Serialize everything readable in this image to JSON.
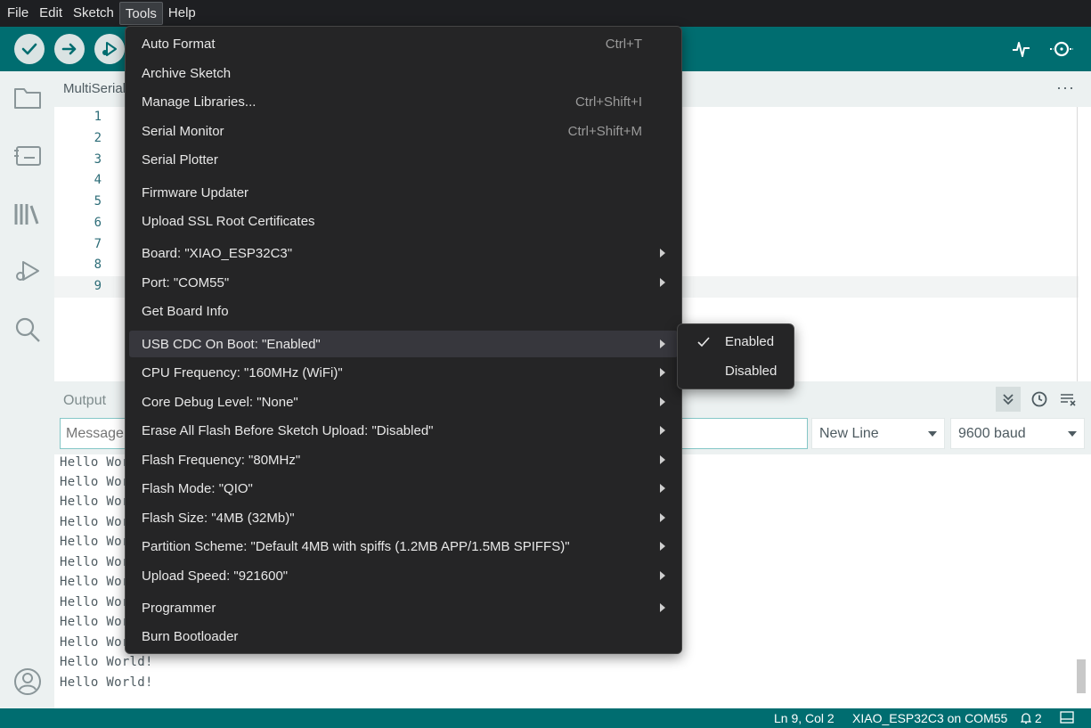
{
  "menubar": {
    "items": [
      "File",
      "Edit",
      "Sketch",
      "Tools",
      "Help"
    ]
  },
  "editor": {
    "tab_label": "MultiSerial",
    "more_label": "···",
    "line_numbers": [
      "1",
      "2",
      "3",
      "4",
      "5",
      "6",
      "7",
      "8",
      "9"
    ]
  },
  "output": {
    "title": "Output",
    "message_placeholder": "Message",
    "line_ending": "New Line",
    "baud": "9600 baud",
    "lines": [
      "Hello World!",
      "Hello World!",
      "Hello World!",
      "Hello World!",
      "Hello World!",
      "Hello World!",
      "Hello World!",
      "Hello World!",
      "Hello World!",
      "Hello World!",
      "Hello World!",
      "Hello World!"
    ]
  },
  "status": {
    "cursor": "Ln 9, Col 2",
    "board_port": "XIAO_ESP32C3 on COM55",
    "notifications": "2"
  },
  "tools_menu": {
    "items": [
      {
        "label": "Auto Format",
        "shortcut": "Ctrl+T"
      },
      {
        "label": "Archive Sketch"
      },
      {
        "label": "Manage Libraries...",
        "shortcut": "Ctrl+Shift+I"
      },
      {
        "label": "Serial Monitor",
        "shortcut": "Ctrl+Shift+M"
      },
      {
        "label": "Serial Plotter"
      },
      {
        "label": "Firmware Updater"
      },
      {
        "label": "Upload SSL Root Certificates"
      },
      {
        "label": "Board: \"XIAO_ESP32C3\"",
        "submenu": true
      },
      {
        "label": "Port: \"COM55\"",
        "submenu": true
      },
      {
        "label": "Get Board Info"
      },
      {
        "label": "USB CDC On Boot: \"Enabled\"",
        "submenu": true,
        "highlighted": true
      },
      {
        "label": "CPU Frequency: \"160MHz (WiFi)\"",
        "submenu": true
      },
      {
        "label": "Core Debug Level: \"None\"",
        "submenu": true
      },
      {
        "label": "Erase All Flash Before Sketch Upload: \"Disabled\"",
        "submenu": true
      },
      {
        "label": "Flash Frequency: \"80MHz\"",
        "submenu": true
      },
      {
        "label": "Flash Mode: \"QIO\"",
        "submenu": true
      },
      {
        "label": "Flash Size: \"4MB (32Mb)\"",
        "submenu": true
      },
      {
        "label": "Partition Scheme: \"Default 4MB with spiffs (1.2MB APP/1.5MB SPIFFS)\"",
        "submenu": true
      },
      {
        "label": "Upload Speed: \"921600\"",
        "submenu": true
      },
      {
        "label": "Programmer",
        "submenu": true
      },
      {
        "label": "Burn Bootloader"
      }
    ]
  },
  "usb_cdc_submenu": {
    "items": [
      {
        "label": "Enabled",
        "checked": true
      },
      {
        "label": "Disabled",
        "checked": false
      }
    ]
  },
  "colors": {
    "accent": "#006d70",
    "menu_bg": "#252526",
    "sidebar_bg": "#ecf1f1"
  }
}
